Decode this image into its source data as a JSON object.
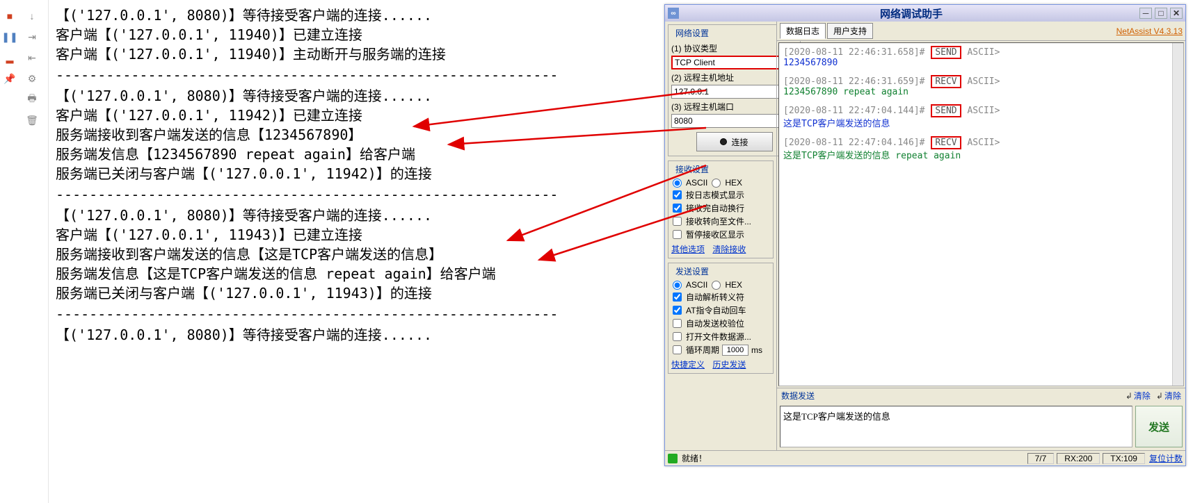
{
  "toolbar": {
    "icons": [
      "record",
      "pause",
      "stop",
      "pin"
    ],
    "right_icons": [
      "arrow-down",
      "step-in",
      "step-out",
      "settings",
      "print",
      "trash"
    ]
  },
  "hr": "------------------------------------------------------------",
  "console": {
    "blocks": [
      [
        "【('127.0.0.1', 8080)】等待接受客户端的连接......",
        "客户端【('127.0.0.1', 11940)】已建立连接",
        "客户端【('127.0.0.1', 11940)】主动断开与服务端的连接"
      ],
      [
        "【('127.0.0.1', 8080)】等待接受客户端的连接......",
        "客户端【('127.0.0.1', 11942)】已建立连接",
        "服务端接收到客户端发送的信息【1234567890】",
        "服务端发信息【1234567890 repeat again】给客户端",
        "服务端已关闭与客户端【('127.0.0.1', 11942)】的连接"
      ],
      [
        "【('127.0.0.1', 8080)】等待接受客户端的连接......",
        "客户端【('127.0.0.1', 11943)】已建立连接",
        "服务端接收到客户端发送的信息【这是TCP客户端发送的信息】",
        "服务端发信息【这是TCP客户端发送的信息 repeat again】给客户端",
        "服务端已关闭与客户端【('127.0.0.1', 11943)】的连接"
      ],
      [
        "【('127.0.0.1', 8080)】等待接受客户端的连接......"
      ]
    ]
  },
  "app": {
    "title": "网络调试助手",
    "version": "NetAssist V4.3.13",
    "net": {
      "legend": "网络设置",
      "proto_label": "(1) 协议类型",
      "proto_value": "TCP Client",
      "host_label": "(2) 远程主机地址",
      "host_value": "127.0.0.1",
      "port_label": "(3) 远程主机端口",
      "port_value": "8080",
      "connect_btn": "连接"
    },
    "recv": {
      "legend": "接收设置",
      "ascii": "ASCII",
      "hex": "HEX",
      "opts": [
        "按日志模式显示",
        "接收完自动换行",
        "接收转向至文件...",
        "暂停接收区显示"
      ],
      "checked": [
        true,
        true,
        false,
        false
      ],
      "link1": "其他选项",
      "link2": "清除接收"
    },
    "send": {
      "legend": "发送设置",
      "ascii": "ASCII",
      "hex": "HEX",
      "opts": [
        "自动解析转义符",
        "AT指令自动回车",
        "自动发送校验位",
        "打开文件数据源...",
        "循环周期"
      ],
      "checked": [
        true,
        true,
        false,
        false,
        false
      ],
      "cycle_val": "1000",
      "cycle_unit": "ms",
      "link1": "快捷定义",
      "link2": "历史发送"
    },
    "tabs": [
      "数据日志",
      "用户支持"
    ],
    "logs": [
      {
        "time": "[2020-08-11 22:46:31.658]",
        "dir": "SEND",
        "enc": "ASCII>",
        "body": "1234567890",
        "cls": "blue"
      },
      {
        "time": "[2020-08-11 22:46:31.659]",
        "dir": "RECV",
        "enc": "ASCII>",
        "body": "1234567890 repeat again",
        "cls": "green"
      },
      {
        "time": "[2020-08-11 22:47:04.144]",
        "dir": "SEND",
        "enc": "ASCII>",
        "body": "这是TCP客户端发送的信息",
        "cls": "blue"
      },
      {
        "time": "[2020-08-11 22:47:04.146]",
        "dir": "RECV",
        "enc": "ASCII>",
        "body": "这是TCP客户端发送的信息 repeat again",
        "cls": "green"
      }
    ],
    "send_section": {
      "legend": "数据发送",
      "clear1": "清除",
      "clear2": "清除",
      "input": "这是TCP客户端发送的信息",
      "button": "发送"
    },
    "status": {
      "ready": "就绪！",
      "count": "7/7",
      "rx": "RX:200",
      "tx": "TX:109",
      "reset": "复位计数"
    }
  },
  "brand": ""
}
